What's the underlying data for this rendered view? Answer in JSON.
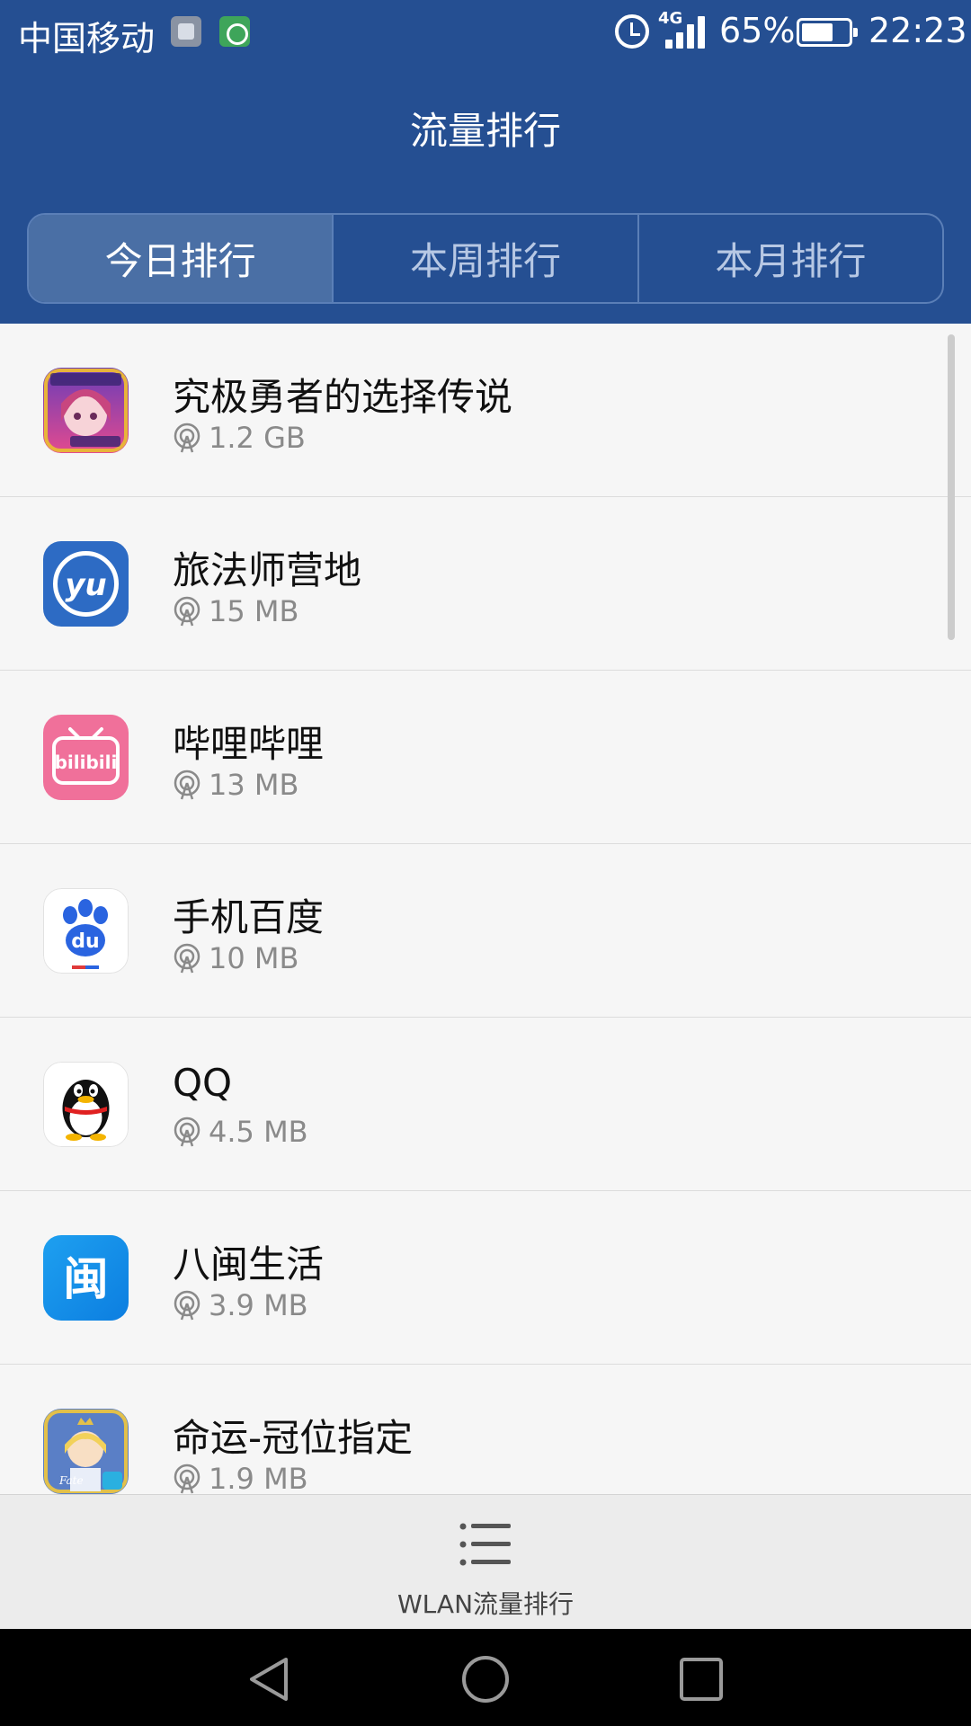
{
  "status_bar": {
    "carrier": "中国移动",
    "network": "4G",
    "battery": "65%",
    "time": "22:23",
    "icons": [
      "gallery-notification-icon",
      "data-transfer-icon",
      "alarm-icon",
      "signal-icon",
      "battery-icon"
    ]
  },
  "header": {
    "title": "流量排行",
    "tabs": [
      {
        "label": "今日排行",
        "active": true
      },
      {
        "label": "本周排行",
        "active": false
      },
      {
        "label": "本月排行",
        "active": false
      }
    ]
  },
  "apps": [
    {
      "name": "究极勇者的选择传说",
      "usage": "1.2 GB",
      "icon": "yuusha-game-icon"
    },
    {
      "name": "旅法师营地",
      "usage": "15 MB",
      "icon": "yu-camp-icon"
    },
    {
      "name": "哔哩哔哩",
      "usage": "13 MB",
      "icon": "bilibili-icon"
    },
    {
      "name": "手机百度",
      "usage": "10 MB",
      "icon": "baidu-paw-icon"
    },
    {
      "name": "QQ",
      "usage": "4.5 MB",
      "icon": "qq-penguin-icon"
    },
    {
      "name": "八闽生活",
      "usage": "3.9 MB",
      "icon": "bamin-icon"
    },
    {
      "name": "命运-冠位指定",
      "usage": "1.9 MB",
      "icon": "fgo-icon"
    }
  ],
  "bottom_bar": {
    "label": "WLAN流量排行",
    "icon": "list-icon"
  },
  "icon_text": {
    "yu": "yu",
    "bilibili": "bilibili",
    "baidu": "du",
    "bamin": "闽",
    "fgo": "Fate"
  },
  "colors": {
    "header": "#254f92",
    "active_tab": "#4a6fa5",
    "background": "#f6f6f6"
  }
}
